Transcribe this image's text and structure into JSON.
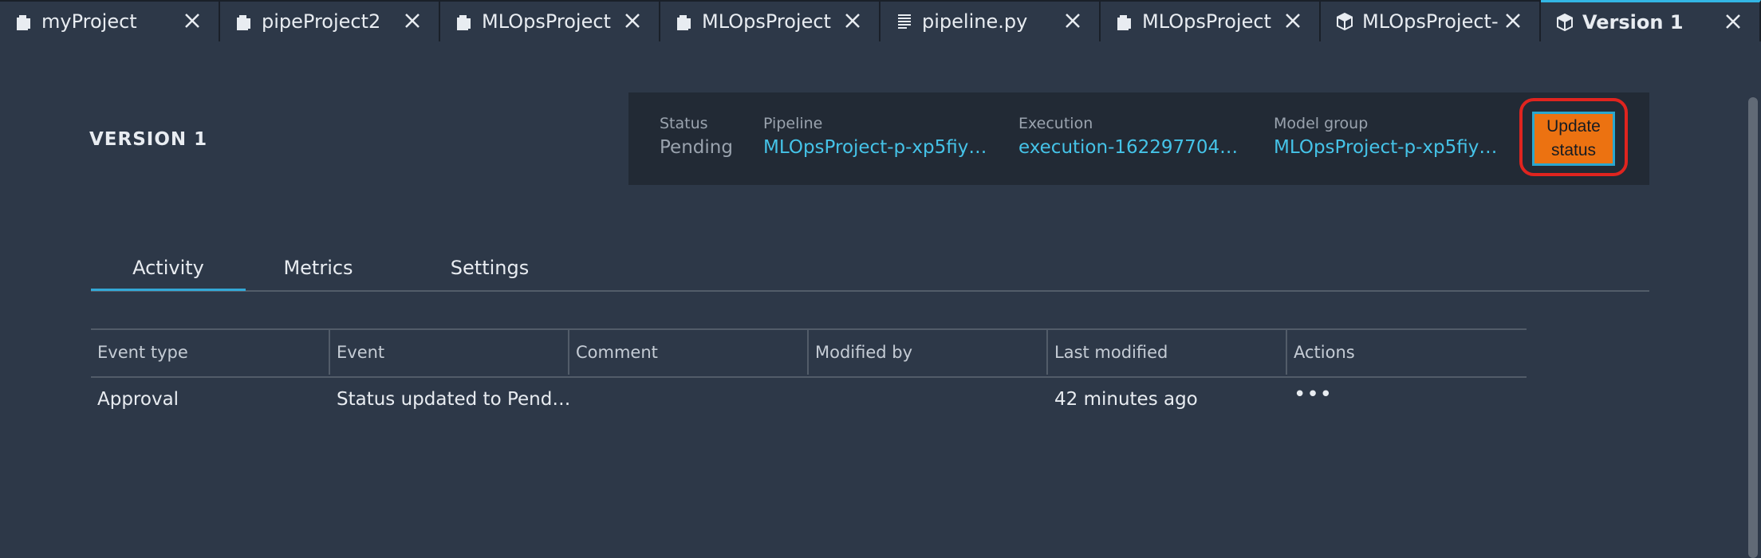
{
  "tabs": [
    {
      "label": "myProject",
      "icon": "project-icon",
      "active": false
    },
    {
      "label": "pipeProject2",
      "icon": "project-icon",
      "active": false
    },
    {
      "label": "MLOpsProject",
      "icon": "project-icon",
      "active": false
    },
    {
      "label": "MLOpsProject",
      "icon": "project-icon",
      "active": false
    },
    {
      "label": "pipeline.py",
      "icon": "file-icon",
      "active": false
    },
    {
      "label": "MLOpsProject",
      "icon": "project-icon",
      "active": false
    },
    {
      "label": "MLOpsProject-p",
      "icon": "package-icon",
      "active": false
    },
    {
      "label": "Version 1",
      "icon": "package-icon",
      "active": true
    }
  ],
  "header": {
    "title": "VERSION 1",
    "status": {
      "label": "Status",
      "value": "Pending"
    },
    "pipeline": {
      "label": "Pipeline",
      "value": "MLOpsProject-p-xp5fiy…"
    },
    "execution": {
      "label": "Execution",
      "value": "execution-162297704…"
    },
    "model_group": {
      "label": "Model group",
      "value": "MLOpsProject-p-xp5fiy…"
    },
    "update_button": "Update status"
  },
  "view_tabs": [
    {
      "label": "Activity",
      "active": true
    },
    {
      "label": "Metrics",
      "active": false
    },
    {
      "label": "Settings",
      "active": false
    }
  ],
  "table": {
    "columns": [
      "Event type",
      "Event",
      "Comment",
      "Modified by",
      "Last modified",
      "Actions"
    ],
    "rows": [
      {
        "event_type": "Approval",
        "event": "Status updated to Pend…",
        "comment": "",
        "modified_by": "",
        "last_modified": "42 minutes ago",
        "actions": "•••"
      }
    ]
  },
  "colors": {
    "background": "#2d3848",
    "link": "#45c3e8",
    "accent_tab": "#33a8d6",
    "button": "#ec7211",
    "highlight": "#e0241f"
  }
}
